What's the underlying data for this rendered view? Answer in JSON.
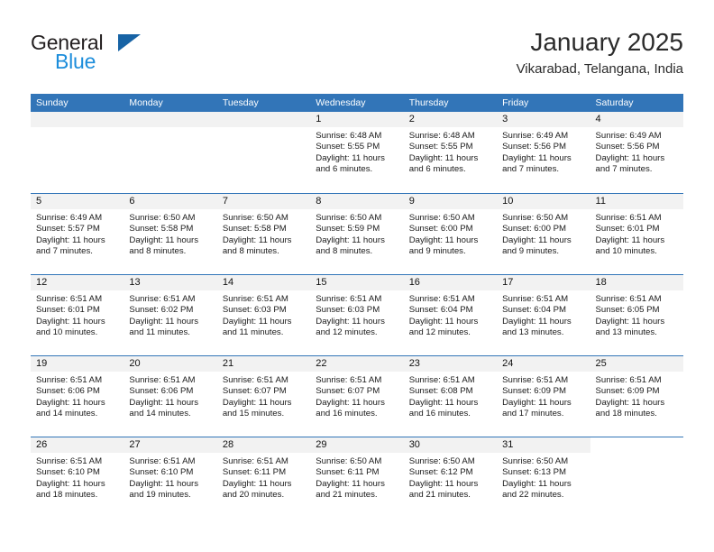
{
  "brand": {
    "name_top": "General",
    "name_bottom": "Blue",
    "triangle_color": "#1763A5",
    "blue_color": "#1C8DDB"
  },
  "header": {
    "title": "January 2025",
    "subtitle": "Vikarabad, Telangana, India"
  },
  "theme": {
    "header_blue": "#3275B8",
    "row_separator": "#3275B8",
    "daynum_background": "#F2F2F2"
  },
  "weekday_headers": [
    "Sunday",
    "Monday",
    "Tuesday",
    "Wednesday",
    "Thursday",
    "Friday",
    "Saturday"
  ],
  "weeks": [
    [
      {
        "day": "",
        "sunrise": "",
        "sunset": "",
        "daylight": "",
        "empty": true
      },
      {
        "day": "",
        "sunrise": "",
        "sunset": "",
        "daylight": "",
        "empty": true
      },
      {
        "day": "",
        "sunrise": "",
        "sunset": "",
        "daylight": "",
        "empty": true
      },
      {
        "day": "1",
        "sunrise": "Sunrise: 6:48 AM",
        "sunset": "Sunset: 5:55 PM",
        "daylight": "Daylight: 11 hours and 6 minutes."
      },
      {
        "day": "2",
        "sunrise": "Sunrise: 6:48 AM",
        "sunset": "Sunset: 5:55 PM",
        "daylight": "Daylight: 11 hours and 6 minutes."
      },
      {
        "day": "3",
        "sunrise": "Sunrise: 6:49 AM",
        "sunset": "Sunset: 5:56 PM",
        "daylight": "Daylight: 11 hours and 7 minutes."
      },
      {
        "day": "4",
        "sunrise": "Sunrise: 6:49 AM",
        "sunset": "Sunset: 5:56 PM",
        "daylight": "Daylight: 11 hours and 7 minutes."
      }
    ],
    [
      {
        "day": "5",
        "sunrise": "Sunrise: 6:49 AM",
        "sunset": "Sunset: 5:57 PM",
        "daylight": "Daylight: 11 hours and 7 minutes."
      },
      {
        "day": "6",
        "sunrise": "Sunrise: 6:50 AM",
        "sunset": "Sunset: 5:58 PM",
        "daylight": "Daylight: 11 hours and 8 minutes."
      },
      {
        "day": "7",
        "sunrise": "Sunrise: 6:50 AM",
        "sunset": "Sunset: 5:58 PM",
        "daylight": "Daylight: 11 hours and 8 minutes."
      },
      {
        "day": "8",
        "sunrise": "Sunrise: 6:50 AM",
        "sunset": "Sunset: 5:59 PM",
        "daylight": "Daylight: 11 hours and 8 minutes."
      },
      {
        "day": "9",
        "sunrise": "Sunrise: 6:50 AM",
        "sunset": "Sunset: 6:00 PM",
        "daylight": "Daylight: 11 hours and 9 minutes."
      },
      {
        "day": "10",
        "sunrise": "Sunrise: 6:50 AM",
        "sunset": "Sunset: 6:00 PM",
        "daylight": "Daylight: 11 hours and 9 minutes."
      },
      {
        "day": "11",
        "sunrise": "Sunrise: 6:51 AM",
        "sunset": "Sunset: 6:01 PM",
        "daylight": "Daylight: 11 hours and 10 minutes."
      }
    ],
    [
      {
        "day": "12",
        "sunrise": "Sunrise: 6:51 AM",
        "sunset": "Sunset: 6:01 PM",
        "daylight": "Daylight: 11 hours and 10 minutes."
      },
      {
        "day": "13",
        "sunrise": "Sunrise: 6:51 AM",
        "sunset": "Sunset: 6:02 PM",
        "daylight": "Daylight: 11 hours and 11 minutes."
      },
      {
        "day": "14",
        "sunrise": "Sunrise: 6:51 AM",
        "sunset": "Sunset: 6:03 PM",
        "daylight": "Daylight: 11 hours and 11 minutes."
      },
      {
        "day": "15",
        "sunrise": "Sunrise: 6:51 AM",
        "sunset": "Sunset: 6:03 PM",
        "daylight": "Daylight: 11 hours and 12 minutes."
      },
      {
        "day": "16",
        "sunrise": "Sunrise: 6:51 AM",
        "sunset": "Sunset: 6:04 PM",
        "daylight": "Daylight: 11 hours and 12 minutes."
      },
      {
        "day": "17",
        "sunrise": "Sunrise: 6:51 AM",
        "sunset": "Sunset: 6:04 PM",
        "daylight": "Daylight: 11 hours and 13 minutes."
      },
      {
        "day": "18",
        "sunrise": "Sunrise: 6:51 AM",
        "sunset": "Sunset: 6:05 PM",
        "daylight": "Daylight: 11 hours and 13 minutes."
      }
    ],
    [
      {
        "day": "19",
        "sunrise": "Sunrise: 6:51 AM",
        "sunset": "Sunset: 6:06 PM",
        "daylight": "Daylight: 11 hours and 14 minutes."
      },
      {
        "day": "20",
        "sunrise": "Sunrise: 6:51 AM",
        "sunset": "Sunset: 6:06 PM",
        "daylight": "Daylight: 11 hours and 14 minutes."
      },
      {
        "day": "21",
        "sunrise": "Sunrise: 6:51 AM",
        "sunset": "Sunset: 6:07 PM",
        "daylight": "Daylight: 11 hours and 15 minutes."
      },
      {
        "day": "22",
        "sunrise": "Sunrise: 6:51 AM",
        "sunset": "Sunset: 6:07 PM",
        "daylight": "Daylight: 11 hours and 16 minutes."
      },
      {
        "day": "23",
        "sunrise": "Sunrise: 6:51 AM",
        "sunset": "Sunset: 6:08 PM",
        "daylight": "Daylight: 11 hours and 16 minutes."
      },
      {
        "day": "24",
        "sunrise": "Sunrise: 6:51 AM",
        "sunset": "Sunset: 6:09 PM",
        "daylight": "Daylight: 11 hours and 17 minutes."
      },
      {
        "day": "25",
        "sunrise": "Sunrise: 6:51 AM",
        "sunset": "Sunset: 6:09 PM",
        "daylight": "Daylight: 11 hours and 18 minutes."
      }
    ],
    [
      {
        "day": "26",
        "sunrise": "Sunrise: 6:51 AM",
        "sunset": "Sunset: 6:10 PM",
        "daylight": "Daylight: 11 hours and 18 minutes."
      },
      {
        "day": "27",
        "sunrise": "Sunrise: 6:51 AM",
        "sunset": "Sunset: 6:10 PM",
        "daylight": "Daylight: 11 hours and 19 minutes."
      },
      {
        "day": "28",
        "sunrise": "Sunrise: 6:51 AM",
        "sunset": "Sunset: 6:11 PM",
        "daylight": "Daylight: 11 hours and 20 minutes."
      },
      {
        "day": "29",
        "sunrise": "Sunrise: 6:50 AM",
        "sunset": "Sunset: 6:11 PM",
        "daylight": "Daylight: 11 hours and 21 minutes."
      },
      {
        "day": "30",
        "sunrise": "Sunrise: 6:50 AM",
        "sunset": "Sunset: 6:12 PM",
        "daylight": "Daylight: 11 hours and 21 minutes."
      },
      {
        "day": "31",
        "sunrise": "Sunrise: 6:50 AM",
        "sunset": "Sunset: 6:13 PM",
        "daylight": "Daylight: 11 hours and 22 minutes."
      },
      {
        "day": "",
        "sunrise": "",
        "sunset": "",
        "daylight": "",
        "blank": true
      }
    ]
  ]
}
